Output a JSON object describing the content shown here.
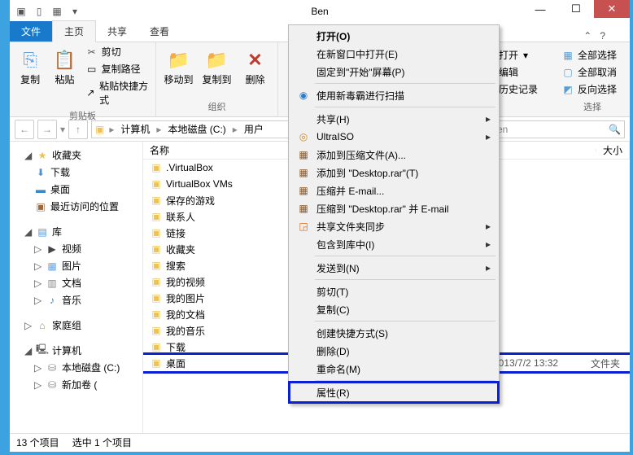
{
  "titlebar": {
    "title": "Ben"
  },
  "tabs": {
    "file": "文件",
    "home": "主页",
    "share": "共享",
    "view": "查看"
  },
  "ribbon": {
    "clipboard": {
      "label": "剪贴板",
      "copy": "复制",
      "paste": "粘贴",
      "cut": "剪切",
      "copypath": "复制路径",
      "pasteshort": "粘贴快捷方式"
    },
    "organize": {
      "label": "组织",
      "moveto": "移动到",
      "copyto": "复制到",
      "delete": "删除"
    },
    "open": {
      "open": "打开",
      "edit": "编辑",
      "history": "历史记录"
    },
    "select": {
      "label": "选择",
      "selectall": "全部选择",
      "selectnone": "全部取消",
      "invert": "反向选择"
    }
  },
  "breadcrumb": {
    "pc": "计算机",
    "c": "本地磁盘 (C:)",
    "users": "用户"
  },
  "search": {
    "placeholder_tail": "en"
  },
  "columns": {
    "name": "名称",
    "size": "大小"
  },
  "nav": {
    "fav": "收藏夹",
    "dl": "下载",
    "desk": "桌面",
    "recent": "最近访问的位置",
    "lib": "库",
    "vid": "视频",
    "pic": "图片",
    "doc": "文档",
    "music": "音乐",
    "home": "家庭组",
    "pc": "计算机",
    "drivec": "本地磁盘 (C:)",
    "drive_new": "新加卷 ("
  },
  "files": [
    ".VirtualBox",
    "VirtualBox VMs",
    "保存的游戏",
    "联系人",
    "链接",
    "收藏夹",
    "搜索",
    "我的视频",
    "我的图片",
    "我的文档",
    "我的音乐",
    "下载",
    "桌面"
  ],
  "sel_row_date": "2013/7/2 13:32",
  "sel_row_type": "文件夹",
  "ctx": [
    "打开(O)",
    "在新窗口中打开(E)",
    "固定到\"开始\"屏幕(P)",
    "使用新毒霸进行扫描",
    "共享(H)",
    "UltraISO",
    "添加到压缩文件(A)...",
    "添加到 \"Desktop.rar\"(T)",
    "压缩并 E-mail...",
    "压缩到 \"Desktop.rar\" 并 E-mail",
    "共享文件夹同步",
    "包含到库中(I)",
    "发送到(N)",
    "剪切(T)",
    "复制(C)",
    "创建快捷方式(S)",
    "删除(D)",
    "重命名(M)",
    "属性(R)"
  ],
  "status": {
    "count": "13 个项目",
    "sel": "选中 1 个项目"
  }
}
